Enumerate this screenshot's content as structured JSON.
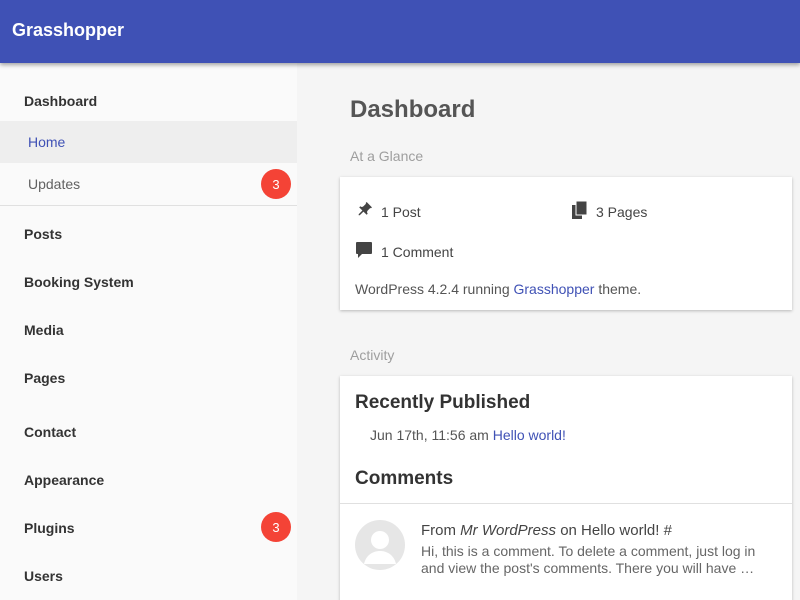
{
  "app": {
    "title": "Grasshopper"
  },
  "sidebar": {
    "dashboard_label": "Dashboard",
    "sub_items": [
      {
        "label": "Home",
        "active": true
      },
      {
        "label": "Updates",
        "badge": "3"
      }
    ],
    "menu": [
      {
        "label": "Posts"
      },
      {
        "label": "Booking System"
      },
      {
        "label": "Media"
      },
      {
        "label": "Pages"
      },
      {
        "label": "Contact"
      },
      {
        "label": "Appearance"
      },
      {
        "label": "Plugins",
        "badge": "3"
      },
      {
        "label": "Users"
      }
    ]
  },
  "main": {
    "title": "Dashboard",
    "at_a_glance": {
      "label": "At a Glance",
      "posts": "1 Post",
      "pages": "3 Pages",
      "comments": "1 Comment",
      "wp_prefix": "WordPress 4.2.4 running",
      "theme_link": "Grasshopper",
      "wp_suffix": "theme."
    },
    "activity": {
      "label": "Activity",
      "recently_published": {
        "heading": "Recently Published",
        "date": "Jun 17th, 11:56 am",
        "post_link": "Hello world!"
      },
      "comments": {
        "heading": "Comments",
        "from_prefix": "From",
        "author": "Mr WordPress",
        "on_text": "on",
        "post_link": "Hello world!",
        "hash": "#",
        "excerpt": "Hi, this is a comment. To delete a comment, just log in and view the post's comments. There you will have …"
      }
    }
  },
  "colors": {
    "topbar": "#3f51b5",
    "accent": "#3f51b5",
    "badge": "#f44336",
    "background": "#f5f5f5"
  },
  "icons": {
    "posts": "pushpin-icon",
    "pages": "pages-icon",
    "comments": "comment-icon",
    "avatar": "default-avatar-icon"
  }
}
